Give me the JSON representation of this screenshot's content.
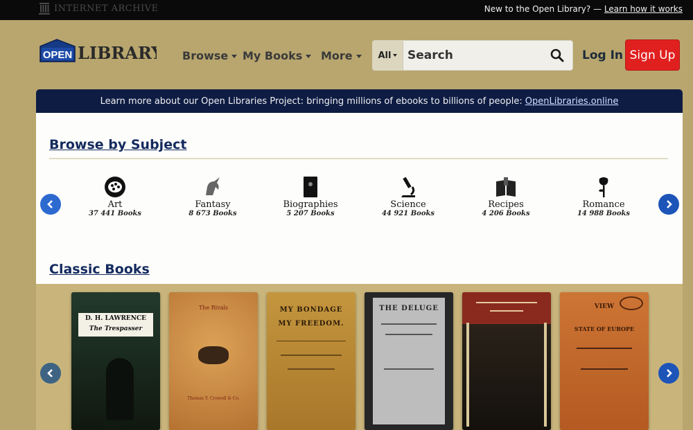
{
  "topbar": {
    "archive_name": "INTERNET ARCHIVE",
    "new_message": "New to the Open Library? —",
    "learn_link": "Learn how it works"
  },
  "header": {
    "logo_open": "OPEN",
    "logo_library": "LIBRARY",
    "nav": [
      {
        "label": "Browse"
      },
      {
        "label": "My Books"
      },
      {
        "label": "More"
      }
    ],
    "search": {
      "scope": "All",
      "placeholder": "Search"
    },
    "login_label": "Log In",
    "signup_label": "Sign Up"
  },
  "banner": {
    "text": "Learn more about our Open Libraries Project: bringing millions of ebooks to billions of people:",
    "link": "OpenLibraries.online"
  },
  "browse_by_subject": {
    "title": "Browse by Subject",
    "subjects": [
      {
        "name": "Art",
        "count": "37 441 Books",
        "icon": "palette-icon"
      },
      {
        "name": "Fantasy",
        "count": "8 673 Books",
        "icon": "unicorn-icon"
      },
      {
        "name": "Biographies",
        "count": "5 207 Books",
        "icon": "book-icon"
      },
      {
        "name": "Science",
        "count": "44 921 Books",
        "icon": "microscope-icon"
      },
      {
        "name": "Recipes",
        "count": "4 206 Books",
        "icon": "cookbook-icon"
      },
      {
        "name": "Romance",
        "count": "14 988 Books",
        "icon": "rose-icon"
      }
    ]
  },
  "classic_books": {
    "title": "Classic Books",
    "books": [
      {
        "line1": "D. H. LAWRENCE",
        "line2": "The Trespasser"
      },
      {
        "line1": "The Rivals",
        "line2": "Thomas Y. Crowell & Co."
      },
      {
        "line1": "MY BONDAGE",
        "line2": "MY FREEDOM."
      },
      {
        "line1": "THE DELUGE",
        "line2": ""
      },
      {
        "line1": "",
        "line2": ""
      },
      {
        "line1": "VIEW",
        "line2": "STATE OF EUROPE"
      }
    ]
  },
  "colors": {
    "page_background": "#b8a66e",
    "banner_background": "#0e1c44",
    "signup": "#e0201f",
    "arrow_blue": "#1c54b8"
  }
}
